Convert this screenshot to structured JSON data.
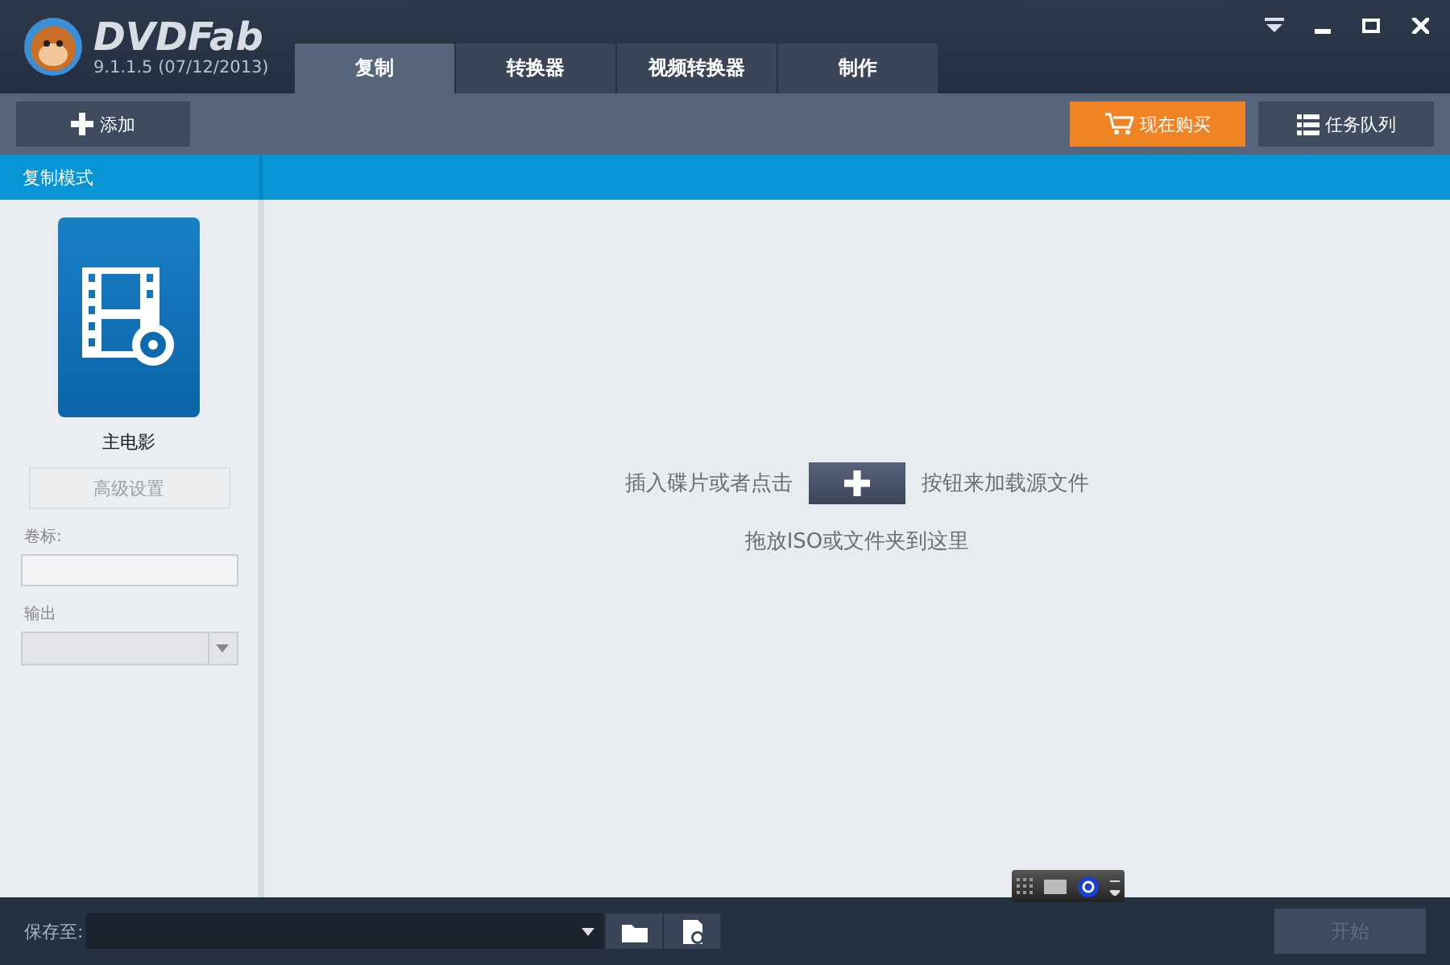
{
  "app": {
    "logo_text": "DVDFab",
    "version": "9.1.1.5 (07/12/2013)"
  },
  "tabs": [
    {
      "label": "复制",
      "selected": true
    },
    {
      "label": "转换器",
      "selected": false
    },
    {
      "label": "视频转换器",
      "selected": false
    },
    {
      "label": "制作",
      "selected": false
    }
  ],
  "toolbar": {
    "add_button": "添加",
    "buy_button": "现在购买",
    "queue_button": "任务队列"
  },
  "sidebar": {
    "header": "复制模式",
    "mode": {
      "label": "主电影",
      "selected": true
    },
    "advanced_button": {
      "label": "高级设置",
      "disabled": true
    },
    "volume_label": "卷标:",
    "output_label": "输出",
    "output_select": {
      "disabled": true
    }
  },
  "main": {
    "hint_before": "插入碟片或者点击",
    "hint_after": "按钮来加载源文件",
    "drop_hint": "拖放ISO或文件夹到这里"
  },
  "bottom_bar": {
    "save_to_label": "保存至:",
    "start_button": {
      "label": "开始",
      "disabled": true
    }
  }
}
